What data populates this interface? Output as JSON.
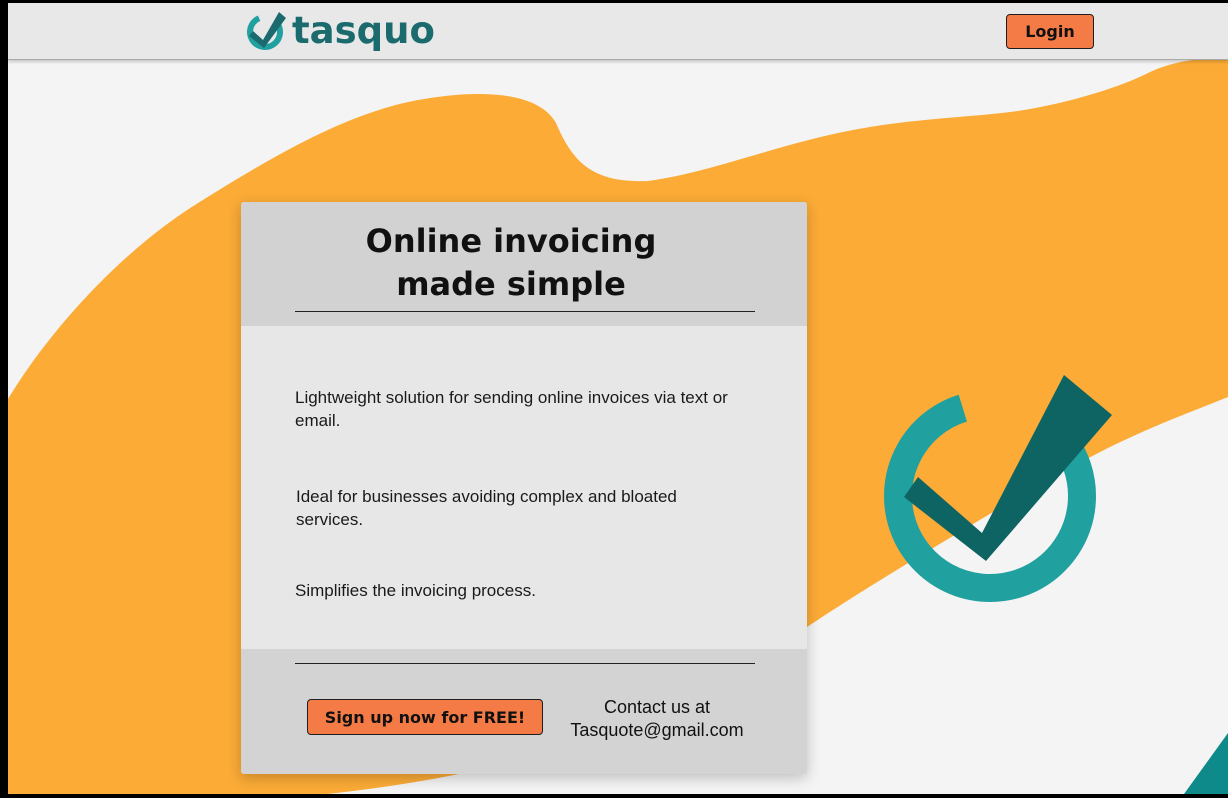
{
  "header": {
    "brand_name": "tasquo",
    "login_label": "Login"
  },
  "card": {
    "title_line1": "Online invoicing",
    "title_line2": "made simple",
    "features": [
      "Lightweight solution for sending online invoices via text or email.",
      "Ideal for businesses avoiding complex and bloated services.",
      "Simplifies the invoicing process."
    ],
    "signup_label": "Sign up now for FREE!",
    "contact_line1": "Contact us at",
    "contact_line2": "Tasquote@gmail.com"
  },
  "colors": {
    "accent_orange": "#fbab36",
    "button_orange": "#f47a46",
    "brand_teal": "#21a0a0",
    "brand_dark_teal": "#0e6463"
  },
  "icons": {
    "logo": "check-circle-icon",
    "hero": "check-circle-icon"
  }
}
